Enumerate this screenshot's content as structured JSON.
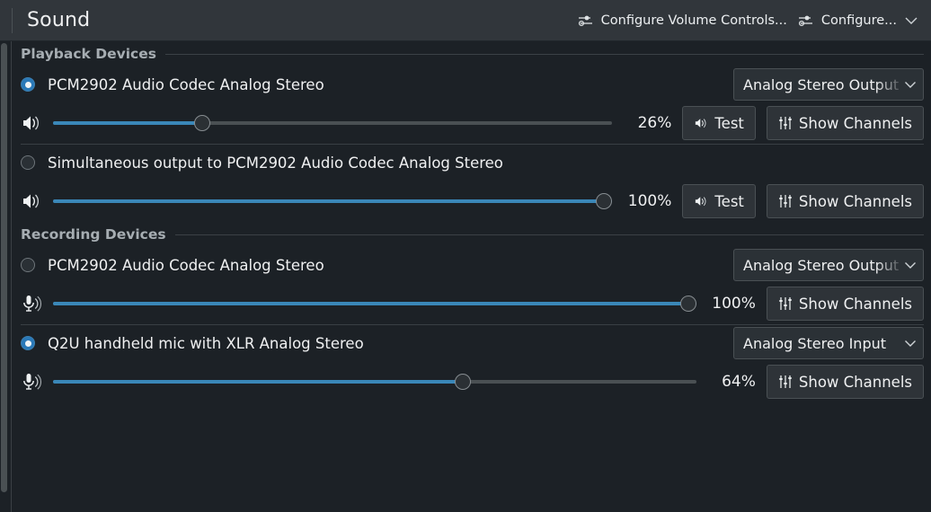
{
  "header": {
    "title": "Sound",
    "buttons": [
      {
        "label": "Configure Volume Controls...",
        "icon": "sliders-icon",
        "has_chevron": false
      },
      {
        "label": "Configure...",
        "icon": "sliders-icon",
        "has_chevron": true
      }
    ]
  },
  "groups": [
    {
      "label": "Playback Devices",
      "devices": [
        {
          "name": "PCM2902 Audio Codec Analog Stereo",
          "selected": true,
          "profile": "Analog Stereo Output",
          "profile_truncated": true,
          "volume_percent": "26%",
          "volume_value": 26,
          "slider_icon": "speaker-icon",
          "buttons": [
            {
              "label": "Test",
              "icon": "speaker-icon"
            },
            {
              "label": "Show Channels",
              "icon": "channels-icon"
            }
          ]
        },
        {
          "name": "Simultaneous output to PCM2902 Audio Codec Analog Stereo",
          "selected": false,
          "profile": null,
          "profile_truncated": false,
          "volume_percent": "100%",
          "volume_value": 100,
          "slider_icon": "speaker-icon",
          "buttons": [
            {
              "label": "Test",
              "icon": "speaker-icon"
            },
            {
              "label": "Show Channels",
              "icon": "channels-icon"
            }
          ]
        }
      ]
    },
    {
      "label": "Recording Devices",
      "devices": [
        {
          "name": "PCM2902 Audio Codec Analog Stereo",
          "selected": false,
          "profile": "Analog Stereo Output",
          "profile_truncated": true,
          "volume_percent": "100%",
          "volume_value": 100,
          "slider_icon": "microphone-icon",
          "buttons": [
            {
              "label": "Show Channels",
              "icon": "channels-icon"
            }
          ]
        },
        {
          "name": "Q2U handheld mic with XLR Analog Stereo",
          "selected": true,
          "profile": "Analog Stereo Input",
          "profile_truncated": false,
          "volume_percent": "64%",
          "volume_value": 64,
          "slider_icon": "microphone-icon",
          "buttons": [
            {
              "label": "Show Channels",
              "icon": "channels-icon"
            }
          ]
        }
      ]
    }
  ],
  "colors": {
    "accent": "#3a87b8",
    "titlebar": "#31363b",
    "background": "#1c2126",
    "text": "#eff0f1",
    "muted": "#a6adb2"
  }
}
